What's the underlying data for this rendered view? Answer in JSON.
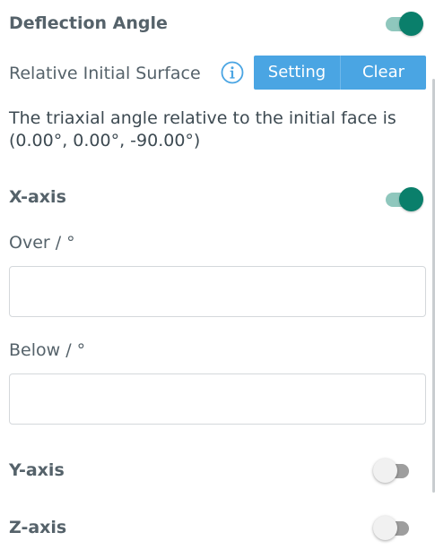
{
  "deflection": {
    "title": "Deflection Angle",
    "enabled": true
  },
  "relative_surface": {
    "label": "Relative Initial Surface",
    "info_icon": "info-icon",
    "setting_label": "Setting",
    "clear_label": "Clear"
  },
  "description": "The triaxial angle relative to the initial face is (0.00°, 0.00°, -90.00°)",
  "x_axis": {
    "title": "X-axis",
    "enabled": true,
    "over_label": "Over / °",
    "over_value": "",
    "below_label": "Below / °",
    "below_value": ""
  },
  "y_axis": {
    "title": "Y-axis",
    "enabled": false
  },
  "z_axis": {
    "title": "Z-axis",
    "enabled": false
  },
  "colors": {
    "accent": "#4aa5e3",
    "toggle_on": "#0a7f6b",
    "toggle_on_track": "#8fc7bd",
    "toggle_off_knob": "#f1f1f1",
    "toggle_off_track": "#9e9e9e"
  }
}
